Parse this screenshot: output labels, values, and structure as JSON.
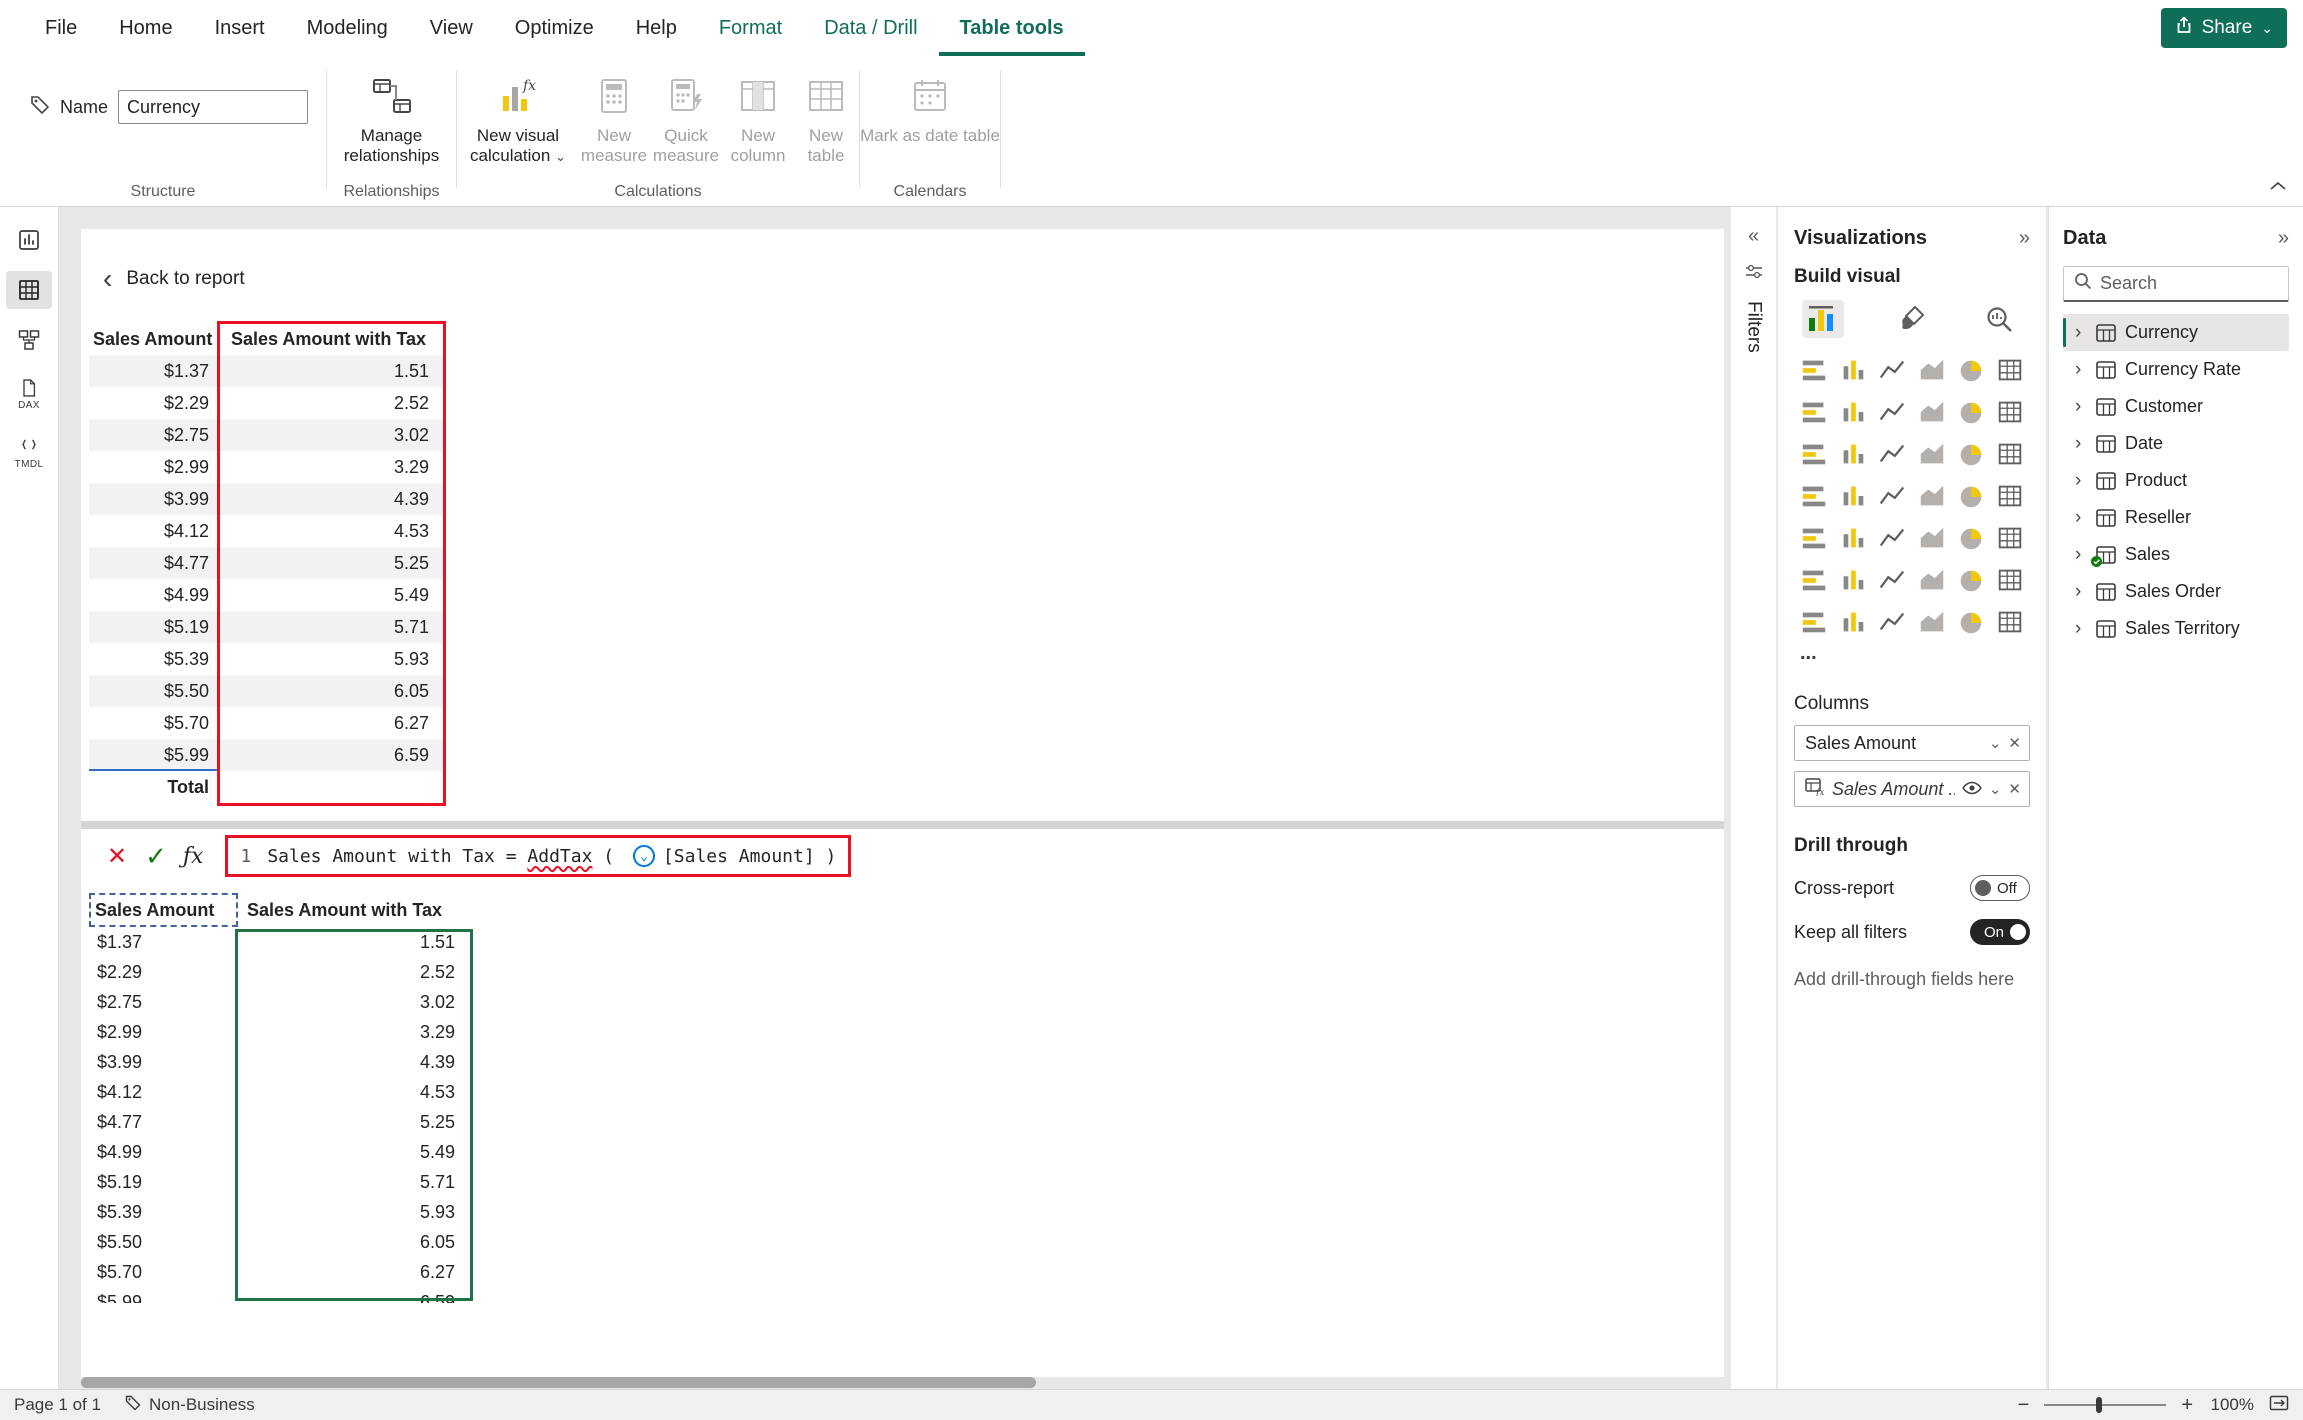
{
  "colors": {
    "accent_green": "#0f6e5a",
    "annotation_red": "#e81123",
    "annotation_green": "#217346",
    "highlight_yellow": "#f2c80f",
    "toggle_on": "#252423"
  },
  "glyphs": {
    "chevron_down": "⌄",
    "chevron_right": "›",
    "collapse_right": "»",
    "expand_left": "«",
    "close": "✕",
    "check": "✓",
    "fx": "ƒx",
    "back": "‹",
    "minus": "−",
    "plus": "+"
  },
  "menu": {
    "items": [
      "File",
      "Home",
      "Insert",
      "Modeling",
      "View",
      "Optimize",
      "Help"
    ],
    "contextual": [
      "Format",
      "Data / Drill",
      "Table tools"
    ],
    "active": "Table tools",
    "share": "Share"
  },
  "ribbon": {
    "name_label": "Name",
    "name_value": "Currency",
    "groups": [
      "Structure",
      "Relationships",
      "Calculations",
      "Calendars"
    ],
    "buttons": {
      "manage_relationships": "Manage relationships",
      "new_visual_calculation": "New visual calculation",
      "new_measure": "New measure",
      "quick_measure": "Quick measure",
      "new_column": "New column",
      "new_table": "New table",
      "mark_as_date_table": "Mark as date table"
    }
  },
  "left_nav": {
    "items": [
      {
        "name": "report-view"
      },
      {
        "name": "table-view",
        "active": true
      },
      {
        "name": "model-view"
      },
      {
        "name": "dax-query-view",
        "label": "DAX"
      },
      {
        "name": "tmdl-view",
        "label": "TMDL"
      }
    ]
  },
  "canvas": {
    "back_link": "Back to report",
    "formula": {
      "line_number": "1",
      "lhs": "Sales Amount with Tax = ",
      "function": "AddTax",
      "open": " ( ",
      "field_ref": "[Sales Amount]",
      "close": " )"
    }
  },
  "table": {
    "columns": [
      "Sales Amount",
      "Sales Amount with Tax"
    ],
    "rows": [
      [
        "$1.37",
        "1.51"
      ],
      [
        "$2.29",
        "2.52"
      ],
      [
        "$2.75",
        "3.02"
      ],
      [
        "$2.99",
        "3.29"
      ],
      [
        "$3.99",
        "4.39"
      ],
      [
        "$4.12",
        "4.53"
      ],
      [
        "$4.77",
        "5.25"
      ],
      [
        "$4.99",
        "5.49"
      ],
      [
        "$5.19",
        "5.71"
      ],
      [
        "$5.39",
        "5.93"
      ],
      [
        "$5.50",
        "6.05"
      ],
      [
        "$5.70",
        "6.27"
      ],
      [
        "$5.99",
        "6.59"
      ]
    ],
    "total_label": "Total"
  },
  "filters_pane": {
    "label": "Filters"
  },
  "visualizations": {
    "title": "Visualizations",
    "build_visual": "Build visual",
    "more": "...",
    "icons": [
      "stacked-bar-chart",
      "stacked-column-chart",
      "clustered-bar-chart",
      "clustered-column-chart",
      "100-stacked-bar-chart",
      "100-stacked-column-chart",
      "line-chart",
      "area-chart",
      "stacked-area-chart",
      "line-and-stacked-column-chart",
      "line-and-clustered-column-chart",
      "ribbon-chart",
      "waterfall-chart",
      "funnel-chart",
      "scatter-chart",
      "pie-chart",
      "donut-chart",
      "treemap",
      "map",
      "filled-map",
      "shape-map",
      "azure-map",
      "gauge",
      "card",
      "multi-row-card",
      "kpi",
      "slicer",
      "table",
      "matrix",
      "r-script-visual",
      "python-visual",
      "key-influencers",
      "decomposition-tree",
      "qa-visual",
      "smart-narrative",
      "metrics",
      "paginated-report",
      "arcgis-map",
      "power-apps",
      "power-automate",
      "new-slicer",
      "calculation-group"
    ],
    "columns_section": {
      "label": "Columns",
      "fields": [
        {
          "name": "Sales Amount",
          "style": "normal"
        },
        {
          "name": "Sales Amount ...",
          "style": "italic"
        }
      ]
    },
    "drill_through": {
      "label": "Drill through",
      "cross_report_label": "Cross-report",
      "cross_report_state": "Off",
      "keep_all_filters_label": "Keep all filters",
      "keep_all_filters_state": "On",
      "hint": "Add drill-through fields here"
    }
  },
  "data_pane": {
    "title": "Data",
    "search_placeholder": "Search",
    "fields": [
      {
        "name": "Currency",
        "selected": true
      },
      {
        "name": "Currency Rate"
      },
      {
        "name": "Customer"
      },
      {
        "name": "Date"
      },
      {
        "name": "Product"
      },
      {
        "name": "Reseller"
      },
      {
        "name": "Sales",
        "checked": true
      },
      {
        "name": "Sales Order"
      },
      {
        "name": "Sales Territory"
      }
    ]
  },
  "status_bar": {
    "page_indicator": "Page 1 of 1",
    "sensitivity_label": "Non-Business",
    "zoom_level": "100%"
  }
}
